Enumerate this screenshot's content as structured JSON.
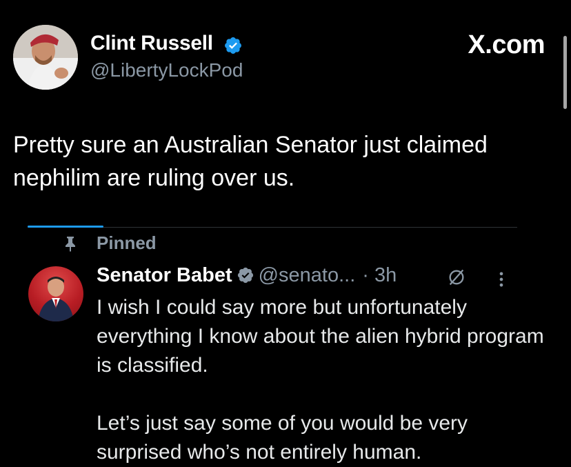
{
  "header": {
    "author_name": "Clint Russell",
    "author_handle": "@LibertyLockPod",
    "site_label": "X.com",
    "verified_icon": "verified-badge-icon"
  },
  "post": {
    "text": "Pretty sure an Australian Senator just claimed nephilim are ruling over us."
  },
  "quoted": {
    "pinned_label": "Pinned",
    "author_name": "Senator Babet",
    "author_handle": "@senato...",
    "time": "· 3h",
    "paragraph1": "I wish I could say more but unfortunately everything I know about the alien hybrid program is classified.",
    "paragraph2": "Let’s just say some of you would be very surprised who’s not entirely human."
  },
  "colors": {
    "background": "#000000",
    "text": "#ffffff",
    "muted": "#8b98a5",
    "accent": "#1d9bf0",
    "divider": "#2f3336"
  }
}
